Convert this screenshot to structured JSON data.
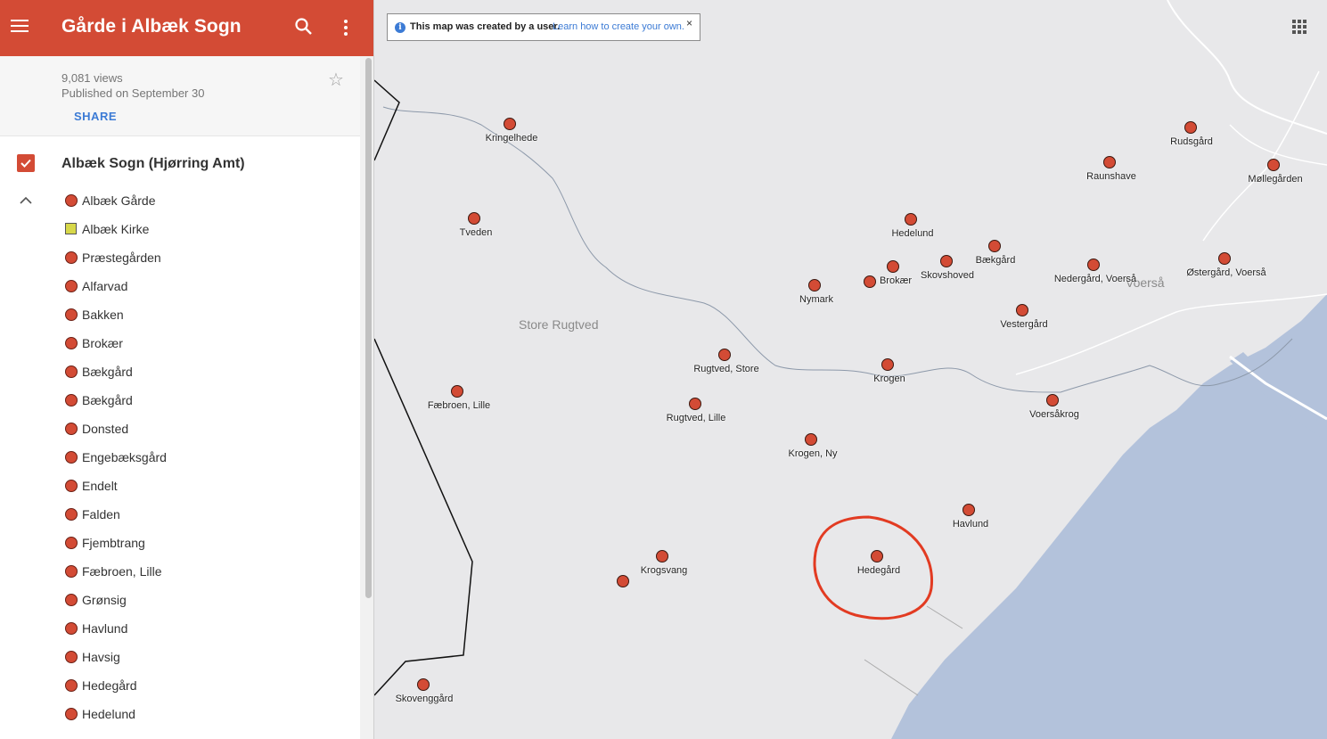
{
  "header": {
    "title": "Gårde i Albæk Sogn"
  },
  "info": {
    "views": "9,081 views",
    "published": "Published on September 30",
    "share_label": "SHARE"
  },
  "layer": {
    "name": "Albæk Sogn (Hjørring Amt)",
    "items": [
      {
        "label": "Albæk Gårde",
        "icon": "circle"
      },
      {
        "label": "Albæk Kirke",
        "icon": "square"
      },
      {
        "label": "Præstegården",
        "icon": "circle"
      },
      {
        "label": "Alfarvad",
        "icon": "circle"
      },
      {
        "label": "Bakken",
        "icon": "circle"
      },
      {
        "label": "Brokær",
        "icon": "circle"
      },
      {
        "label": "Bækgård",
        "icon": "circle"
      },
      {
        "label": "Bækgård",
        "icon": "circle"
      },
      {
        "label": "Donsted",
        "icon": "circle"
      },
      {
        "label": "Engebæksgård",
        "icon": "circle"
      },
      {
        "label": "Endelt",
        "icon": "circle"
      },
      {
        "label": "Falden",
        "icon": "circle"
      },
      {
        "label": "Fjembtrang",
        "icon": "circle"
      },
      {
        "label": "Fæbroen, Lille",
        "icon": "circle"
      },
      {
        "label": "Grønsig",
        "icon": "circle"
      },
      {
        "label": "Havlund",
        "icon": "circle"
      },
      {
        "label": "Havsig",
        "icon": "circle"
      },
      {
        "label": "Hedegård",
        "icon": "circle"
      },
      {
        "label": "Hedelund",
        "icon": "circle"
      }
    ]
  },
  "notice": {
    "text": "This map was created by a user.",
    "link": "Learn how to create your own.",
    "close": "×"
  },
  "map": {
    "place_labels": [
      "Store Rugtved",
      "Voerså"
    ],
    "pins": [
      "Kringelhede",
      "Tveden",
      "Fæbroen, Lille",
      "Rugtved, Store",
      "Rugtved, Lille",
      "Krogsvang",
      "",
      "Skovenggård",
      "Nymark",
      "Brokær",
      "Hedelund",
      "Skovshoved",
      "Bækgård",
      "Krogen",
      "Krogen, Ny",
      "Hedegård",
      "Havlund",
      "Vestergård",
      "Voersåkrog",
      "Nedergård, Voerså",
      "Raunshave",
      "Rudsgård",
      "Møllegården",
      "Østergård, Voerså"
    ]
  },
  "colors": {
    "header": "#d34b35",
    "marker": "#d34b35",
    "water": "#b3c2db",
    "link": "#3c7bd5",
    "highlight": "#e23b22"
  }
}
